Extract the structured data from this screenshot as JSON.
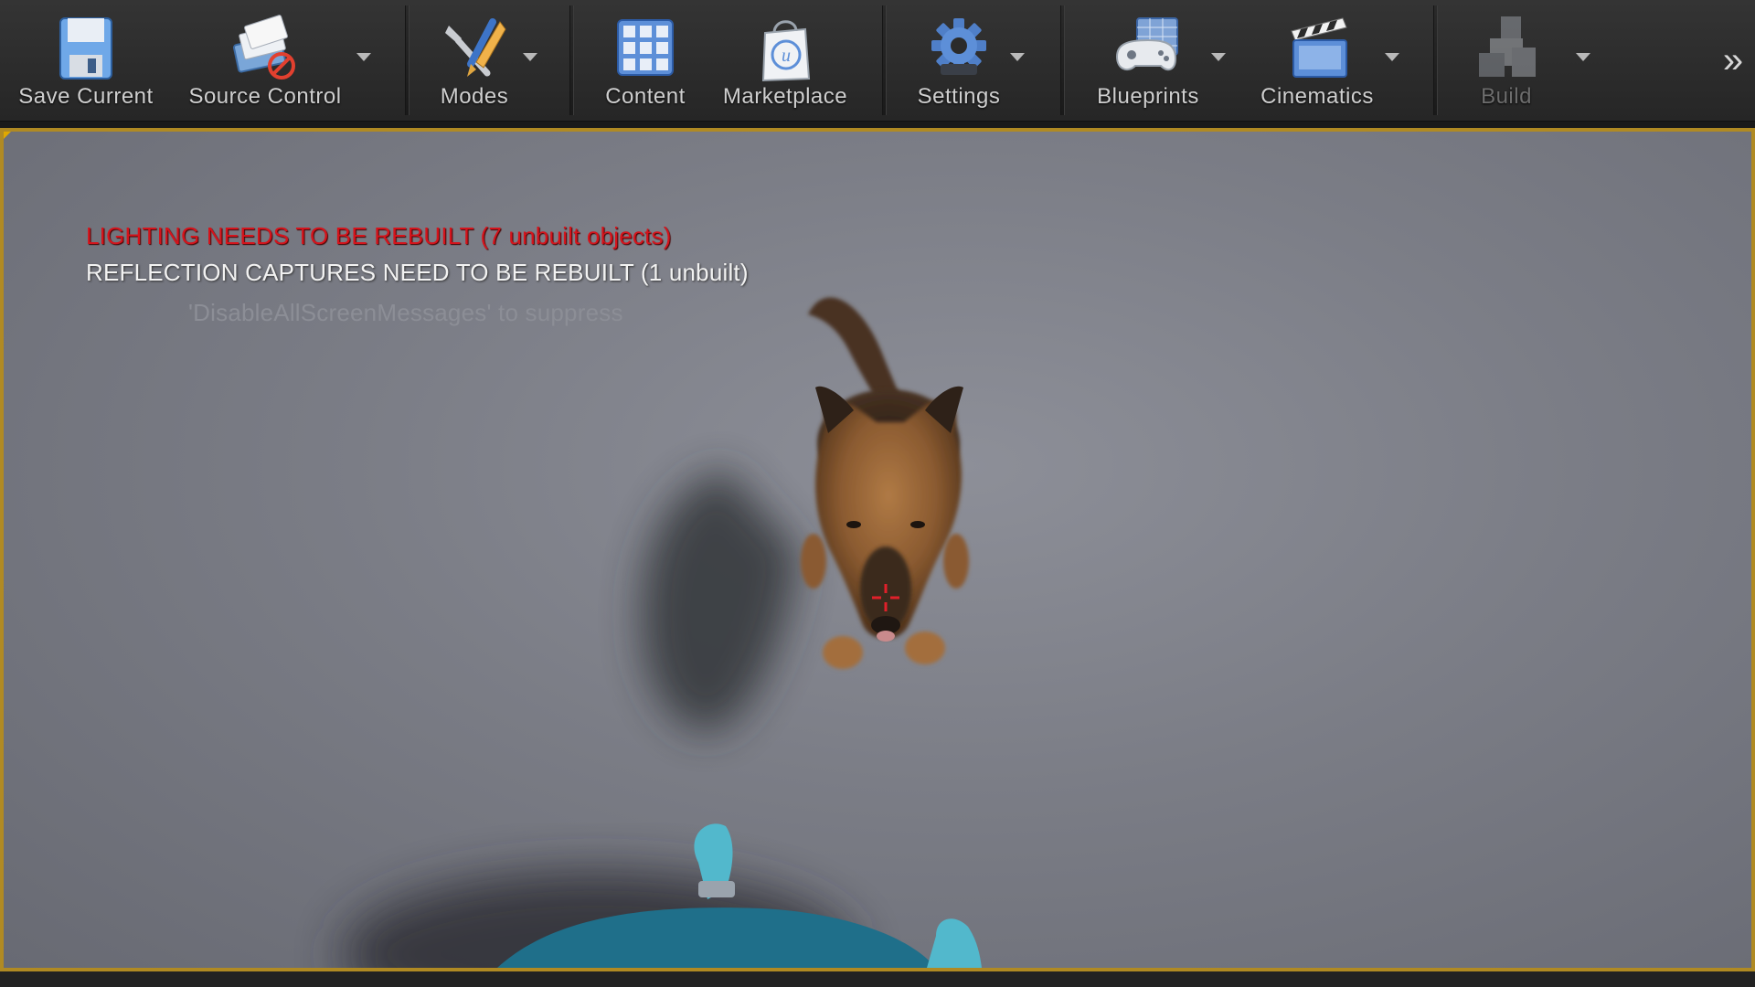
{
  "toolbar": {
    "buttons": [
      {
        "id": "save-current",
        "label": "Save Current",
        "icon": "floppy-disk-icon"
      },
      {
        "id": "source-control",
        "label": "Source Control",
        "icon": "source-control-icon"
      },
      {
        "id": "modes",
        "label": "Modes",
        "icon": "modes-tools-icon"
      },
      {
        "id": "content",
        "label": "Content",
        "icon": "content-grid-icon"
      },
      {
        "id": "marketplace",
        "label": "Marketplace",
        "icon": "marketplace-bag-icon"
      },
      {
        "id": "settings",
        "label": "Settings",
        "icon": "settings-gear-icon"
      },
      {
        "id": "blueprints",
        "label": "Blueprints",
        "icon": "blueprints-gamepad-icon"
      },
      {
        "id": "cinematics",
        "label": "Cinematics",
        "icon": "clapperboard-icon"
      },
      {
        "id": "build",
        "label": "Build",
        "icon": "build-blocks-icon",
        "disabled": true
      }
    ],
    "overflow_glyph": "»"
  },
  "viewport": {
    "messages": {
      "lighting": "LIGHTING NEEDS TO BE REBUILT (7 unbuilt objects)",
      "reflection": "REFLECTION CAPTURES NEED TO BE REBUILT (1 unbuilt)",
      "suppress": "'DisableAllScreenMessages' to suppress"
    },
    "colors": {
      "error": "#d5141c",
      "warning_text": "#f2f2f2",
      "hint_text": "#8c8e96",
      "selection_border": "#b08a23",
      "crosshair": "#e0202a"
    }
  }
}
